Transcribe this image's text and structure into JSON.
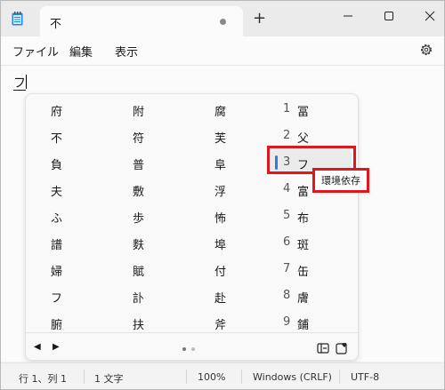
{
  "tab": {
    "title": "不"
  },
  "menu": {
    "file": "ファイル",
    "edit": "編集",
    "view": "表示"
  },
  "editor": {
    "text": "フ"
  },
  "candidates": {
    "col1": [
      "府",
      "不",
      "負",
      "夫",
      "ふ",
      "譜",
      "婦",
      "フ",
      "腑"
    ],
    "col2": [
      "附",
      "符",
      "普",
      "敷",
      "歩",
      "麩",
      "賦",
      "訃",
      "扶"
    ],
    "col3": [
      "腐",
      "芙",
      "阜",
      "浮",
      "怖",
      "埠",
      "付",
      "赴",
      "斧"
    ],
    "numbers": [
      "1",
      "2",
      "3",
      "4",
      "5",
      "6",
      "7",
      "8",
      "9"
    ],
    "col4": [
      "冨",
      "父",
      "フ",
      "富",
      "布",
      "斑",
      "缶",
      "膚",
      "鋪"
    ],
    "selected_index": 3,
    "tooltip": "環境依存"
  },
  "status": {
    "position": "行 1、列 1",
    "chars": "1 文字",
    "zoom": "100%",
    "line_ending": "Windows (CRLF)",
    "encoding": "UTF-8"
  },
  "colors": {
    "accent": "#2b7de1",
    "highlight": "#e2161b"
  }
}
